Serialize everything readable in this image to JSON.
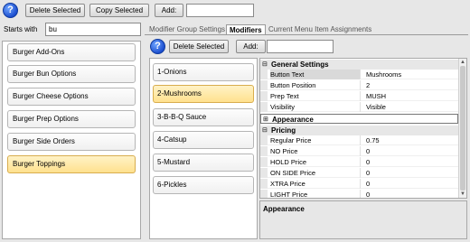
{
  "toolbar": {
    "help": "?",
    "delete_selected": "Delete Selected",
    "copy_selected": "Copy Selected",
    "add_label": "Add:",
    "add_value": ""
  },
  "filter": {
    "label": "Starts with",
    "value": "bu"
  },
  "groups": [
    {
      "label": "Burger Add-Ons"
    },
    {
      "label": "Burger Bun Options"
    },
    {
      "label": "Burger Cheese Options"
    },
    {
      "label": "Burger Prep Options"
    },
    {
      "label": "Burger Side Orders"
    },
    {
      "label": "Burger Toppings"
    }
  ],
  "tabs": [
    {
      "label": "Modifier Group Settings"
    },
    {
      "label": "Modifiers"
    },
    {
      "label": "Current Menu Item Assignments"
    }
  ],
  "modifiers_toolbar": {
    "help": "?",
    "delete_selected": "Delete Selected",
    "add_label": "Add:",
    "add_value": ""
  },
  "modifiers": [
    {
      "label": "1-Onions"
    },
    {
      "label": "2-Mushrooms"
    },
    {
      "label": "3-B-B-Q Sauce"
    },
    {
      "label": "4-Catsup"
    },
    {
      "label": "5-Mustard"
    },
    {
      "label": "6-Pickles"
    }
  ],
  "property_grid": {
    "categories": {
      "general": {
        "label": "General Settings",
        "toggle": "⊟"
      },
      "appearance": {
        "label": "Appearance",
        "toggle": "⊞"
      },
      "pricing": {
        "label": "Pricing",
        "toggle": "⊟"
      }
    },
    "general_rows": [
      {
        "name": "Button Text",
        "value": "Mushrooms"
      },
      {
        "name": "Button Position",
        "value": "2"
      },
      {
        "name": "Prep Text",
        "value": "MUSH"
      },
      {
        "name": "Visibility",
        "value": "Visible"
      }
    ],
    "pricing_rows": [
      {
        "name": "Regular Price",
        "value": "0.75"
      },
      {
        "name": "NO Price",
        "value": "0"
      },
      {
        "name": "HOLD Price",
        "value": "0"
      },
      {
        "name": "ON SIDE Price",
        "value": "0"
      },
      {
        "name": "XTRA Price",
        "value": "0"
      },
      {
        "name": "LIGHT Price",
        "value": "0"
      }
    ]
  },
  "description": {
    "title": "Appearance"
  }
}
